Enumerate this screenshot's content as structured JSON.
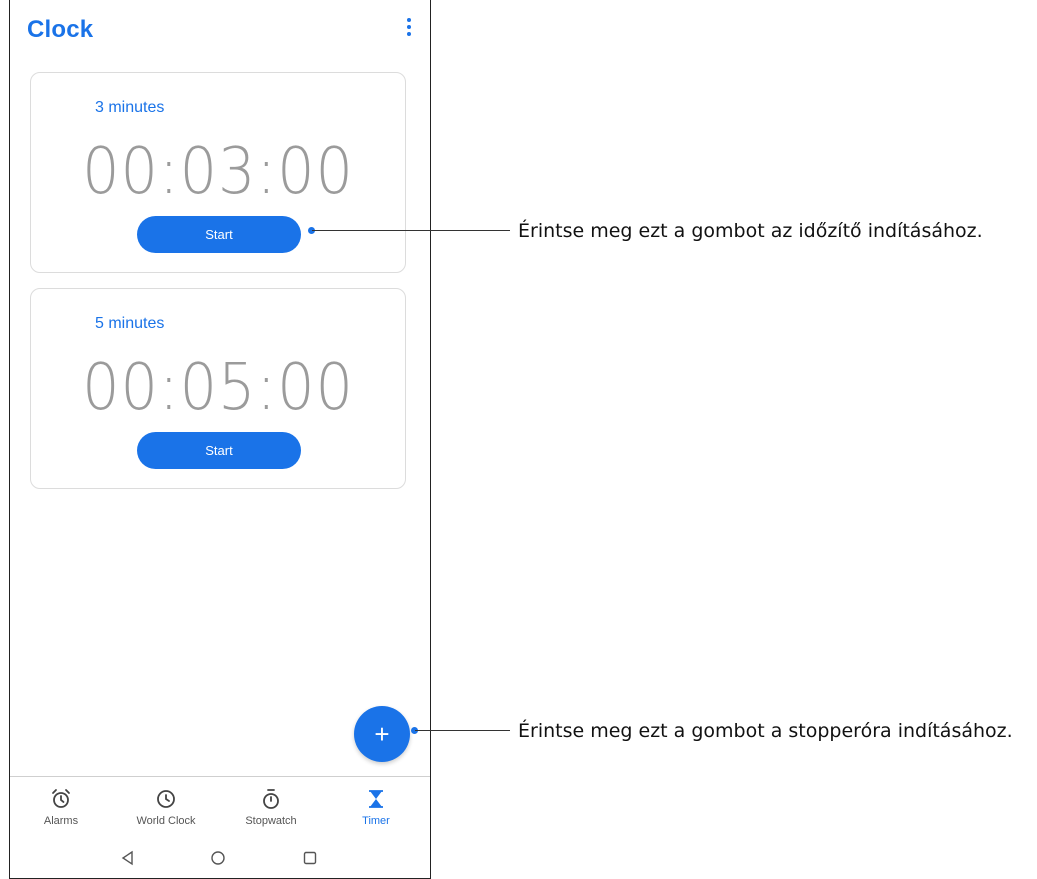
{
  "app": {
    "title": "Clock",
    "menu_icon": "more-vert-icon"
  },
  "timers": [
    {
      "label": "3 minutes",
      "time": "00:03:00",
      "start_label": "Start"
    },
    {
      "label": "5 minutes",
      "time": "00:05:00",
      "start_label": "Start"
    }
  ],
  "fab": {
    "label": "+",
    "icon": "plus-icon"
  },
  "nav": [
    {
      "label": "Alarms",
      "icon": "alarm-icon",
      "active": false
    },
    {
      "label": "World Clock",
      "icon": "clock-icon",
      "active": false
    },
    {
      "label": "Stopwatch",
      "icon": "stopwatch-icon",
      "active": false
    },
    {
      "label": "Timer",
      "icon": "hourglass-icon",
      "active": true
    }
  ],
  "system_nav": [
    "back-icon",
    "home-icon",
    "recents-icon"
  ],
  "callouts": [
    {
      "text": "Érintse meg ezt a gombot az időzítő indításához."
    },
    {
      "text": "Érintse meg ezt a gombot a stopperóra indításához."
    }
  ],
  "colors": {
    "accent": "#1a73e8",
    "time_text": "#8a8a8a",
    "border": "#dcdcdc"
  }
}
